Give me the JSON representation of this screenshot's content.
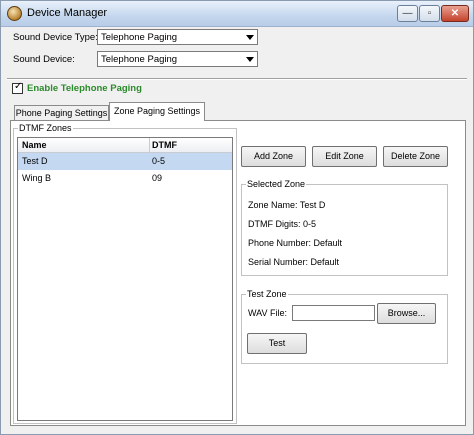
{
  "window": {
    "title": "Device Manager"
  },
  "caption_buttons": {
    "minimize": "—",
    "maximize": "▫",
    "close": "✕"
  },
  "form": {
    "sound_device_type_label": "Sound Device Type:",
    "sound_device_type_value": "Telephone Paging",
    "sound_device_label": "Sound Device:",
    "sound_device_value": "Telephone Paging"
  },
  "enable_paging": {
    "label": "Enable Telephone Paging",
    "checked": true,
    "check_glyph": "✓"
  },
  "tabs": [
    {
      "label": "Phone Paging Settings",
      "active": false
    },
    {
      "label": "Zone Paging Settings",
      "active": true
    }
  ],
  "dtmf_zones": {
    "group_title": "DTMF Zones",
    "columns": [
      "Name",
      "DTMF"
    ],
    "rows": [
      {
        "name": "Test D",
        "dtmf": "0-5",
        "selected": true
      },
      {
        "name": "Wing B",
        "dtmf": "09",
        "selected": false
      }
    ]
  },
  "buttons": {
    "add_zone": "Add Zone",
    "edit_zone": "Edit Zone",
    "delete_zone": "Delete Zone"
  },
  "selected_zone": {
    "group_title": "Selected Zone",
    "zone_name": "Zone Name: Test D",
    "dtmf_digits": "DTMF Digits: 0-5",
    "phone_number": "Phone Number: Default",
    "serial_number": "Serial Number: Default"
  },
  "test_zone": {
    "group_title": "Test Zone",
    "wav_file_label": "WAV File:",
    "wav_file_value": "",
    "browse_label": "Browse...",
    "test_label": "Test"
  },
  "colors": {
    "enable_label": "#2b8a2b",
    "selection": "#c4d8f2"
  }
}
